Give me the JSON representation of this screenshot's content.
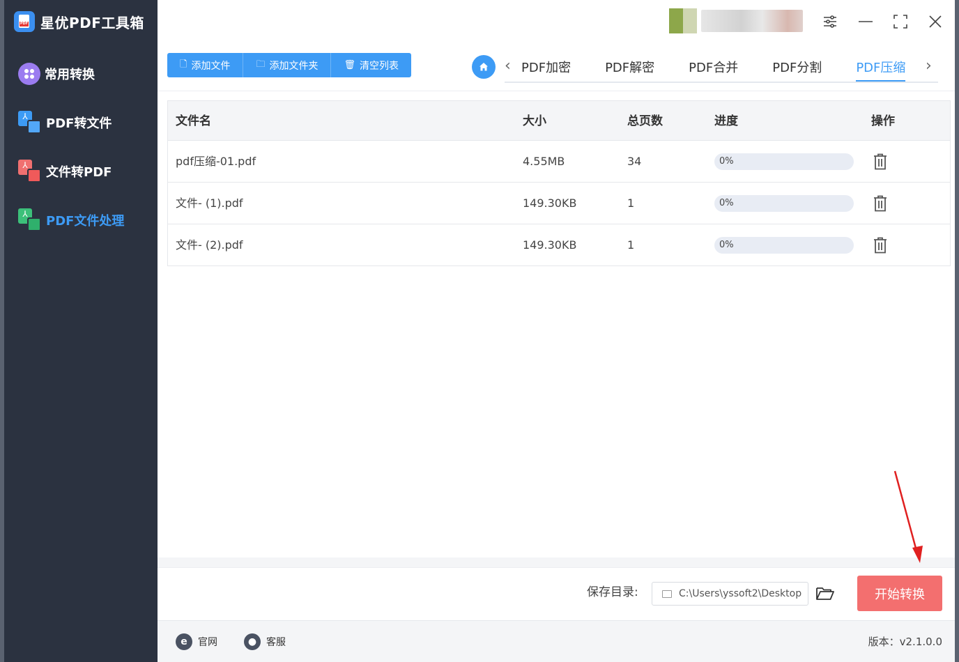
{
  "app": {
    "title": "星优PDF工具箱"
  },
  "sidebar": {
    "items": [
      {
        "label": "常用转换",
        "icon": "grid-icon",
        "active": false
      },
      {
        "label": "PDF转文件",
        "icon": "pdf-to-file-icon",
        "active": false
      },
      {
        "label": "文件转PDF",
        "icon": "file-to-pdf-icon",
        "active": false
      },
      {
        "label": "PDF文件处理",
        "icon": "pdf-process-icon",
        "active": true
      }
    ]
  },
  "toolbar": {
    "add_file": "添加文件",
    "add_folder": "添加文件夹",
    "clear_list": "清空列表"
  },
  "tabs": {
    "items": [
      "PDF加密",
      "PDF解密",
      "PDF合并",
      "PDF分割",
      "PDF压缩"
    ],
    "active": "PDF压缩"
  },
  "table": {
    "headers": {
      "name": "文件名",
      "size": "大小",
      "pages": "总页数",
      "progress": "进度",
      "action": "操作"
    },
    "rows": [
      {
        "name": "pdf压缩-01.pdf",
        "size": "4.55MB",
        "pages": "34",
        "progress_label": "0%",
        "progress": 0
      },
      {
        "name": "文件- (1).pdf",
        "size": "149.30KB",
        "pages": "1",
        "progress_label": "0%",
        "progress": 0
      },
      {
        "name": "文件- (2).pdf",
        "size": "149.30KB",
        "pages": "1",
        "progress_label": "0%",
        "progress": 0
      }
    ]
  },
  "save": {
    "label": "保存目录:",
    "path": "C:\\Users\\yssoft2\\Desktop",
    "start_button": "开始转换"
  },
  "footer": {
    "website": "官网",
    "support": "客服",
    "version": "版本：v2.1.0.0"
  },
  "colors": {
    "accent": "#3d9bf5",
    "sidebar_bg": "#2b3240",
    "start_button": "#f36f6f",
    "annotation_arrow": "#e02020"
  }
}
